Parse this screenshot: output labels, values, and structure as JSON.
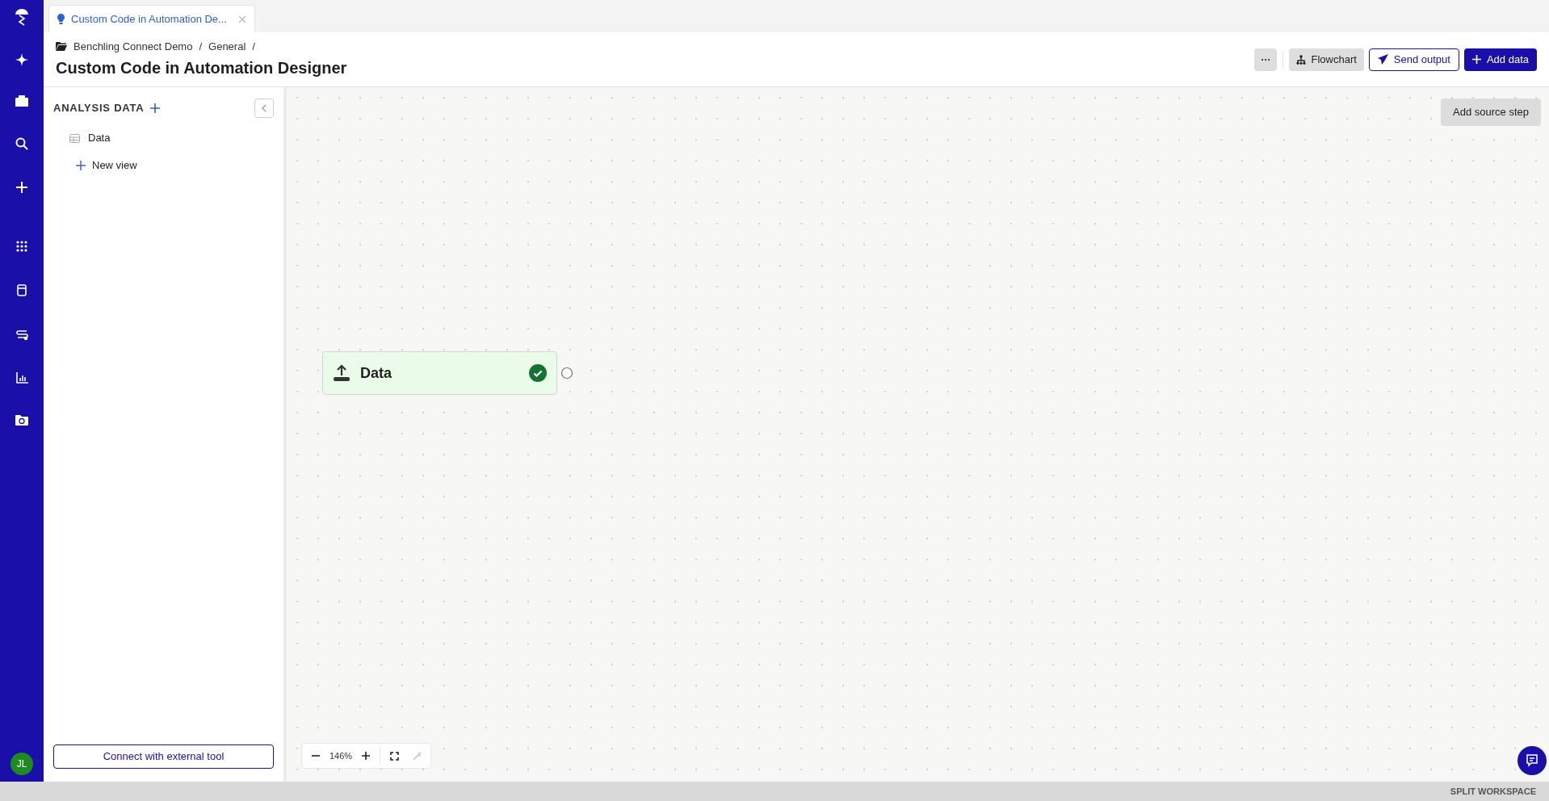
{
  "nav_rail": {
    "avatar": "JL"
  },
  "tabs": [
    {
      "label": "Custom Code in Automation De...",
      "selected": true
    }
  ],
  "breadcrumb": [
    {
      "label": "Benchling Connect Demo",
      "separator": "/"
    },
    {
      "label": "General",
      "separator": "/"
    }
  ],
  "title": "Custom Code in Automation Designer",
  "toolbar": {
    "more": "···",
    "buttons": [
      {
        "label": "Flowchart",
        "kind": "secondary"
      },
      {
        "label": "Send output",
        "kind": "outline"
      },
      {
        "label": "Add data",
        "kind": "primary"
      }
    ]
  },
  "sidebar": {
    "heading": "ANALYSIS DATA",
    "items": [
      {
        "label": "Data",
        "kind": "table"
      },
      {
        "label": "New view",
        "kind": "add"
      }
    ],
    "connect_button": "Connect with external tool"
  },
  "canvas": {
    "add_source_step": "Add source step",
    "nodes": [
      {
        "label": "Data",
        "complete": true
      }
    ],
    "zoom": "146%"
  },
  "footer": "SPLIT WORKSPACE"
}
